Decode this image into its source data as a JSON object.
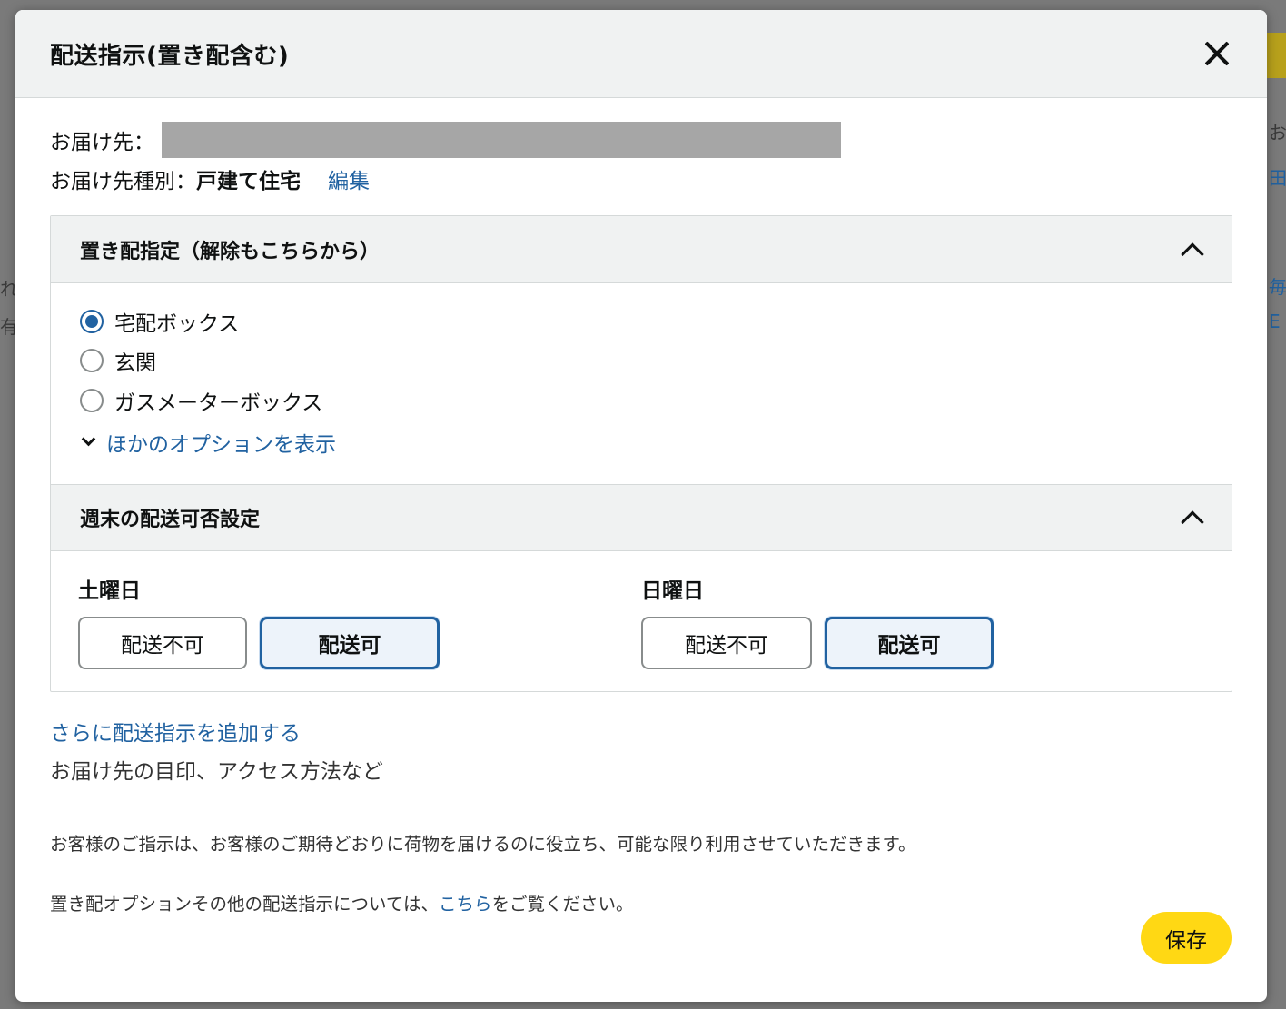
{
  "modal": {
    "title": "配送指示(置き配含む)",
    "close_icon": "close-icon"
  },
  "destination": {
    "label": "お届け先：",
    "type_label": "お届け先種別：",
    "type_value": "戸建て住宅",
    "edit_link": "編集"
  },
  "safe_place": {
    "header": "置き配指定（解除もこちらから）",
    "options": [
      {
        "label": "宅配ボックス",
        "checked": true
      },
      {
        "label": "玄関",
        "checked": false
      },
      {
        "label": "ガスメーターボックス",
        "checked": false
      }
    ],
    "more_options": "ほかのオプションを表示"
  },
  "weekend": {
    "header": "週末の配送可否設定",
    "saturday": {
      "label": "土曜日",
      "unavailable": "配送不可",
      "available": "配送可",
      "selected": "available"
    },
    "sunday": {
      "label": "日曜日",
      "unavailable": "配送不可",
      "available": "配送可",
      "selected": "available"
    }
  },
  "additional": {
    "link": "さらに配送指示を追加する",
    "subtext": "お届け先の目印、アクセス方法など"
  },
  "notes": {
    "note1": "お客様のご指示は、お客様のご期待どおりに荷物を届けるのに役立ち、可能な限り利用させていただきます。",
    "note2_prefix": "置き配オプションその他の配送指示については、",
    "note2_link": "こちら",
    "note2_suffix": "をご覧ください。"
  },
  "save_button": "保存",
  "colors": {
    "accent_blue": "#2162a1",
    "save_yellow": "#ffd814",
    "header_gray": "#f0f2f2"
  }
}
